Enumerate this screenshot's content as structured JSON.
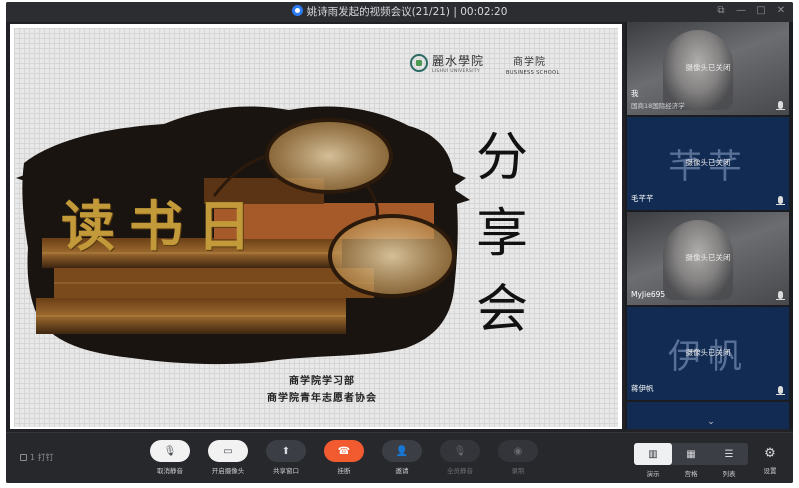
{
  "window": {
    "title": "姚诗雨发起的视频会议(21/21) | 00:02:20",
    "controls": [
      "pop-out",
      "minimize",
      "maximize",
      "close"
    ]
  },
  "slide": {
    "university_cn": "麗水學院",
    "university_en": "LISHUI UNIVERSITY",
    "department_cn": "商学院",
    "department_en": "BUSINESS SCHOOL",
    "main_title": "读书日",
    "vertical_title": [
      "分",
      "享",
      "会"
    ],
    "organizers": [
      "商学院学习部",
      "商学院青年志愿者协会"
    ]
  },
  "participants": [
    {
      "name": "我",
      "subtitle": "国商18国际经济学",
      "status": "摄像头已关闭",
      "tile": "photo",
      "avatar_text": ""
    },
    {
      "name": "毛芊芊",
      "subtitle": "",
      "status": "摄像头已关闭",
      "tile": "blue",
      "avatar_text": "芊芊"
    },
    {
      "name": "MyJie695",
      "subtitle": "",
      "status": "摄像头已关闭",
      "tile": "photo",
      "avatar_text": ""
    },
    {
      "name": "蒋伊帆",
      "subtitle": "",
      "status": "摄像头已关闭",
      "tile": "blue",
      "avatar_text": "伊帆"
    }
  ],
  "toolbar": {
    "lock_label": "1 打钉",
    "buttons": [
      {
        "label": "取消静音",
        "icon": "microphone-icon"
      },
      {
        "label": "开启摄像头",
        "icon": "camera-icon"
      },
      {
        "label": "共享窗口",
        "icon": "share-screen-icon"
      },
      {
        "label": "挂断",
        "icon": "hang-up-icon"
      },
      {
        "label": "邀请",
        "icon": "invite-icon"
      },
      {
        "label": "全员静音",
        "icon": "mute-all-icon"
      },
      {
        "label": "录制",
        "icon": "record-icon"
      }
    ],
    "views": [
      {
        "label": "演示",
        "active": true
      },
      {
        "label": "宫格",
        "active": false
      },
      {
        "label": "列表",
        "active": false
      }
    ],
    "settings_label": "设置"
  },
  "colors": {
    "hang_up": "#f25a30",
    "title_gold": "#c29a3a",
    "tile_blue": "#112b53"
  }
}
